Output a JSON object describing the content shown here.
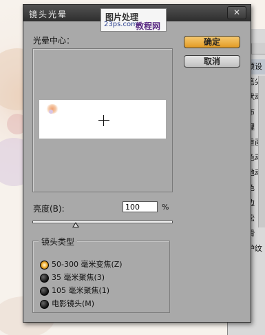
{
  "dialog": {
    "title": "镜头光晕",
    "close_glyph": "✕",
    "preview_label": "光晕中心：",
    "ok_label": "确定",
    "cancel_label": "取消",
    "brightness_label": "亮度(B):",
    "brightness_value": "100",
    "brightness_unit": "%",
    "brightness_slider_percent": 100,
    "lens_group_title": "镜头类型",
    "lens_options": [
      {
        "label": "50-300 毫米变焦(Z)",
        "checked": true
      },
      {
        "label": "35 毫米聚焦(3)",
        "checked": false
      },
      {
        "label": "105 毫米聚焦(1)",
        "checked": false
      },
      {
        "label": "电影镜头(M)",
        "checked": false
      }
    ]
  },
  "watermark": {
    "line1": "图片处理",
    "line2": "23ps.com",
    "line3": "教程网"
  },
  "side_panel": {
    "tab1": "×",
    "tab2": "",
    "items": [
      "预设",
      "笔尖",
      "状动",
      "布",
      "理",
      "重画",
      "色动",
      "他动",
      "色",
      "边",
      "松",
      "滑",
      "护纹"
    ]
  }
}
